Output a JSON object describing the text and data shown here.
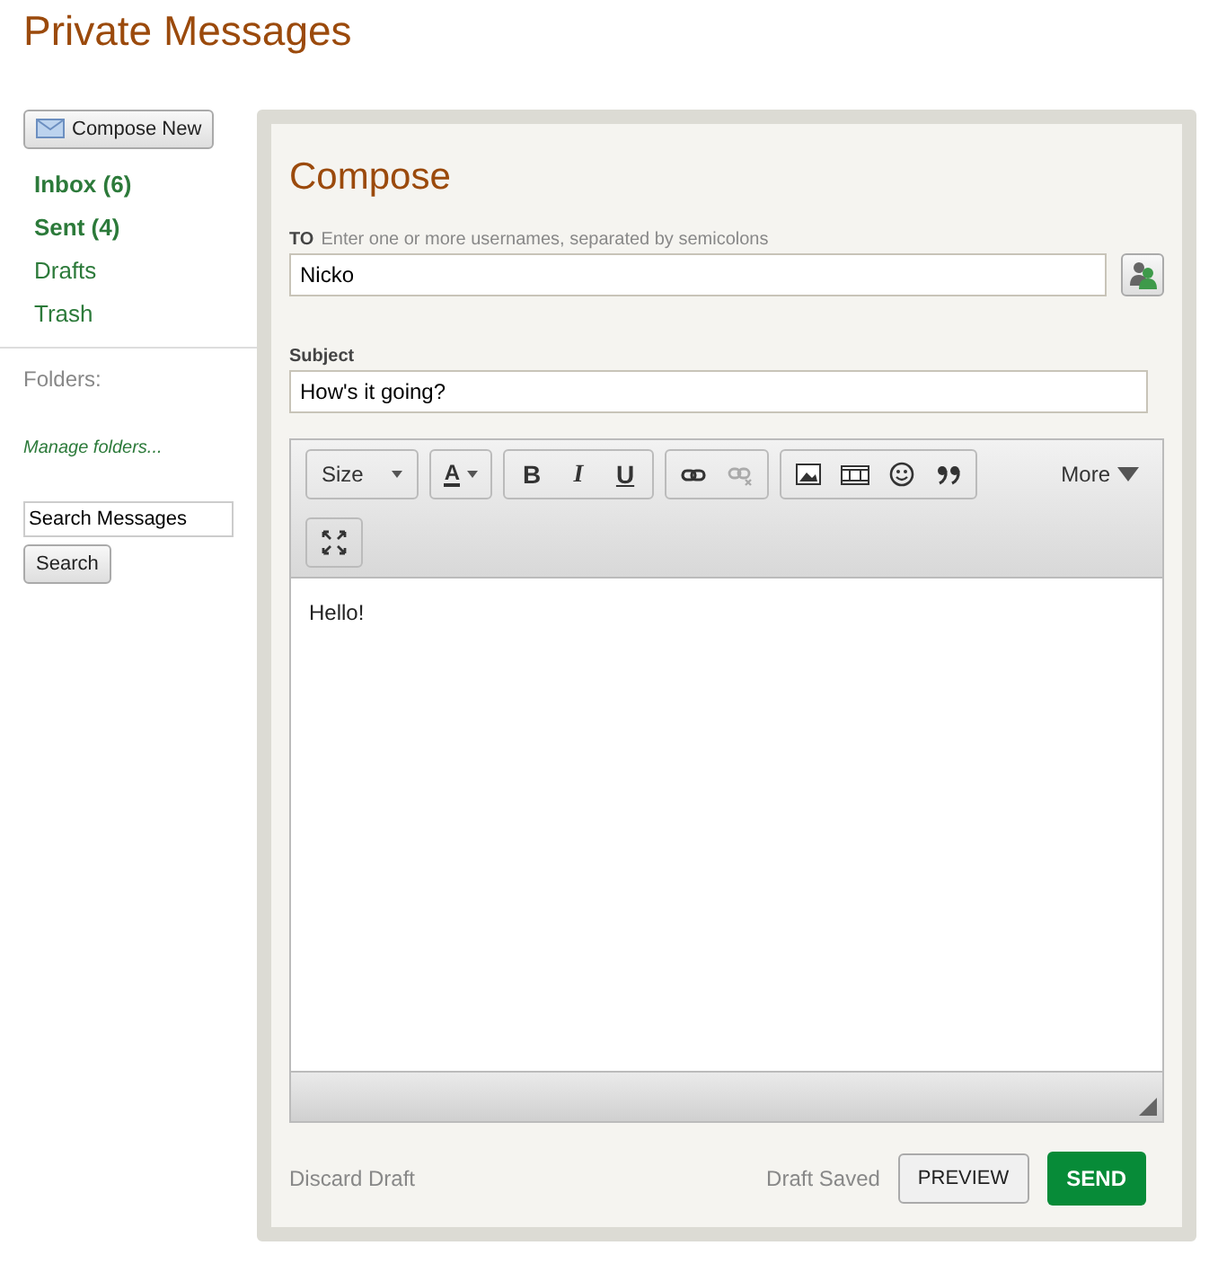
{
  "page_title": "Private Messages",
  "sidebar": {
    "compose_button": "Compose New",
    "folders": [
      {
        "label": "Inbox (6)",
        "unread": true
      },
      {
        "label": "Sent (4)",
        "unread": true
      },
      {
        "label": "Drafts",
        "unread": false
      },
      {
        "label": "Trash",
        "unread": false
      }
    ],
    "folders_label": "Folders:",
    "manage_link": "Manage folders...",
    "search": {
      "value": "Search Messages",
      "button": "Search"
    }
  },
  "compose": {
    "title": "Compose",
    "to": {
      "label": "TO",
      "hint": "Enter one or more usernames, separated by semicolons",
      "value": "Nicko"
    },
    "subject": {
      "label": "Subject",
      "value": "How's it going?"
    },
    "toolbar": [
      [
        {
          "kind": "size",
          "label": "Size",
          "disabled": false
        }
      ],
      [
        {
          "kind": "color",
          "label": "A",
          "disabled": false
        }
      ],
      [
        {
          "kind": "bold",
          "label": "B",
          "disabled": false
        },
        {
          "kind": "italic",
          "label": "I",
          "disabled": false
        },
        {
          "kind": "underline",
          "label": "U",
          "disabled": false
        }
      ],
      [
        {
          "kind": "link",
          "disabled": false
        },
        {
          "kind": "unlink",
          "disabled": true
        }
      ],
      [
        {
          "kind": "image",
          "disabled": false
        },
        {
          "kind": "media",
          "disabled": false
        },
        {
          "kind": "smiley",
          "disabled": false
        },
        {
          "kind": "quote",
          "disabled": false
        }
      ],
      [
        {
          "kind": "fullscreen",
          "disabled": false
        }
      ]
    ],
    "more_button": "More",
    "body": "Hello!",
    "discard": "Discard Draft",
    "status": "Draft Saved",
    "preview": "PREVIEW",
    "send": "SEND"
  }
}
